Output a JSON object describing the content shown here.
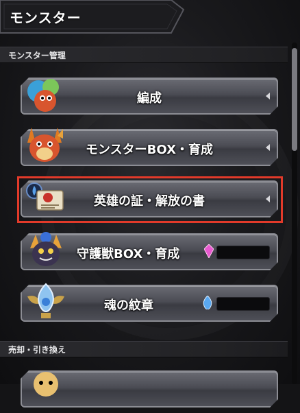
{
  "header": {
    "title": "モンスター"
  },
  "sections": {
    "monster_management": "モンスター管理",
    "sell_exchange": "売却・引き換え"
  },
  "menu": {
    "formation": "編成",
    "monster_box": "モンスターBOX・育成",
    "hero_proof": "英雄の証・解放の書",
    "guardian_box": "守護獣BOX・育成",
    "soul_crest": "魂の紋章"
  },
  "colors": {
    "highlight": "#e23a2a",
    "button_top": "#6a6b73",
    "button_bottom": "#3a3b42"
  },
  "icons": [
    "monster-team-icon",
    "dragon-monster-icon",
    "scroll-book-icon",
    "guardian-beast-icon",
    "soul-crest-icon",
    "pink-crystal-icon",
    "blue-flame-icon"
  ]
}
